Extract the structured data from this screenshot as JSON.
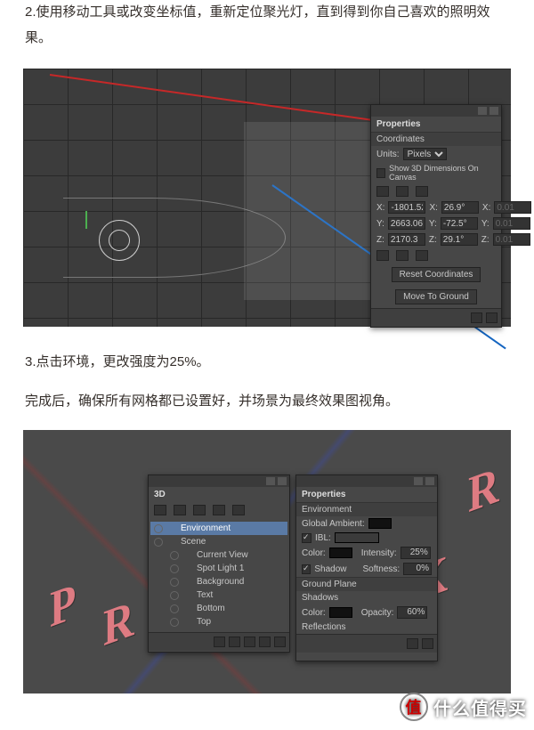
{
  "step2": "2.使用移动工具或改变坐标值，重新定位聚光灯，直到得到你自己喜欢的照明效果。",
  "step3a": "3.点击环境，更改强度为25%。",
  "step3b": "完成后，确保所有网格都已设置好，并场景为最终效果图视角。",
  "coord": {
    "title": "Properties",
    "tab": "Coordinates",
    "unitsLabel": "Units:",
    "unitsValue": "Pixels",
    "show3D": "Show 3D Dimensions On Canvas",
    "X": "-1801.52",
    "Xr": "26.9°",
    "Xs": "0.01",
    "Y": "2663.06",
    "Yr": "-72.5°",
    "Ys": "0.01",
    "Z": "2170.3",
    "Zr": "29.1°",
    "Zs": "0.01",
    "reset": "Reset Coordinates",
    "moveGround": "Move To Ground"
  },
  "panel3d": {
    "title": "3D",
    "items": [
      {
        "label": "Environment",
        "sel": true,
        "ind": 0
      },
      {
        "label": "Scene",
        "ind": 0
      },
      {
        "label": "Current View",
        "ind": 1,
        "icon": "cam"
      },
      {
        "label": "Spot Light 1",
        "ind": 1,
        "icon": "light"
      },
      {
        "label": "Background",
        "ind": 1
      },
      {
        "label": "Text",
        "ind": 1
      },
      {
        "label": "Bottom",
        "ind": 1
      },
      {
        "label": "Top",
        "ind": 1
      }
    ]
  },
  "env": {
    "title": "Properties",
    "tab": "Environment",
    "globalAmbient": "Global Ambient:",
    "ibl": "IBL:",
    "intensityLabel": "Intensity:",
    "intensity": "25%",
    "colorLabel": "Color:",
    "shadow": "Shadow",
    "softnessLabel": "Softness:",
    "softness": "0%",
    "groundPlane": "Ground Plane",
    "shadows": "Shadows",
    "opacityLabel": "Opacity:",
    "opacity": "60%",
    "reflections": "Reflections"
  },
  "watermark": {
    "badge": "值",
    "text": "什么值得买"
  }
}
